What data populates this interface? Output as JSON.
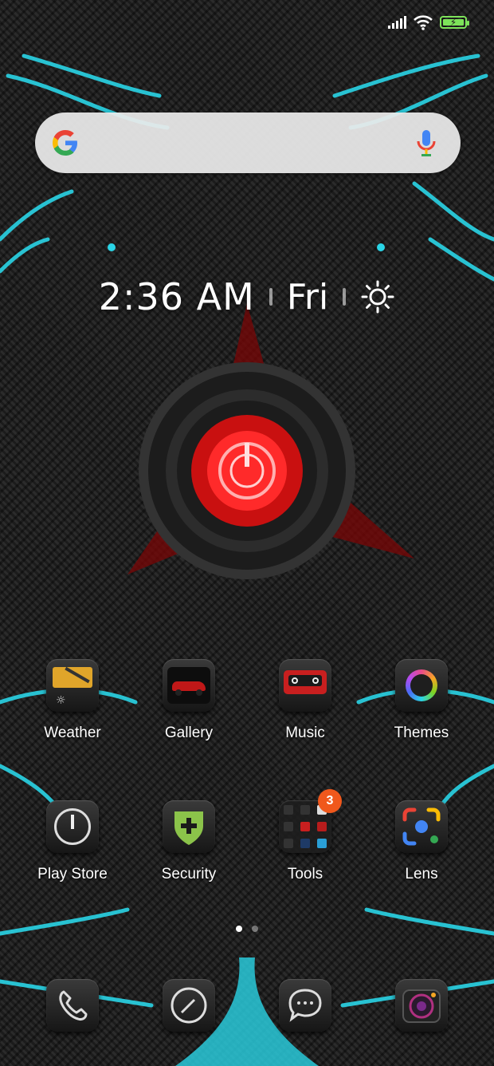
{
  "clock": {
    "time": "2:36 AM",
    "day": "Fri"
  },
  "search": {
    "engine_icon": "google-g-icon",
    "mic_icon": "mic-icon"
  },
  "apps_row1": [
    {
      "label": "Weather",
      "icon": "weather-icon"
    },
    {
      "label": "Gallery",
      "icon": "gallery-icon"
    },
    {
      "label": "Music",
      "icon": "music-icon"
    },
    {
      "label": "Themes",
      "icon": "themes-icon"
    }
  ],
  "apps_row2": [
    {
      "label": "Play Store",
      "icon": "play-store-icon"
    },
    {
      "label": "Security",
      "icon": "security-icon"
    },
    {
      "label": "Tools",
      "icon": "tools-folder-icon",
      "badge": "3"
    },
    {
      "label": "Lens",
      "icon": "lens-icon"
    }
  ],
  "dock": [
    {
      "icon": "phone-icon"
    },
    {
      "icon": "browser-icon"
    },
    {
      "icon": "messages-icon"
    },
    {
      "icon": "camera-icon"
    }
  ],
  "page_indicator": {
    "pages": 2,
    "current": 1
  },
  "colors": {
    "accent_cyan": "#2ad4e6",
    "accent_red": "#ff1a1a",
    "battery_green": "#7de35a",
    "badge_orange": "#f0581c"
  }
}
